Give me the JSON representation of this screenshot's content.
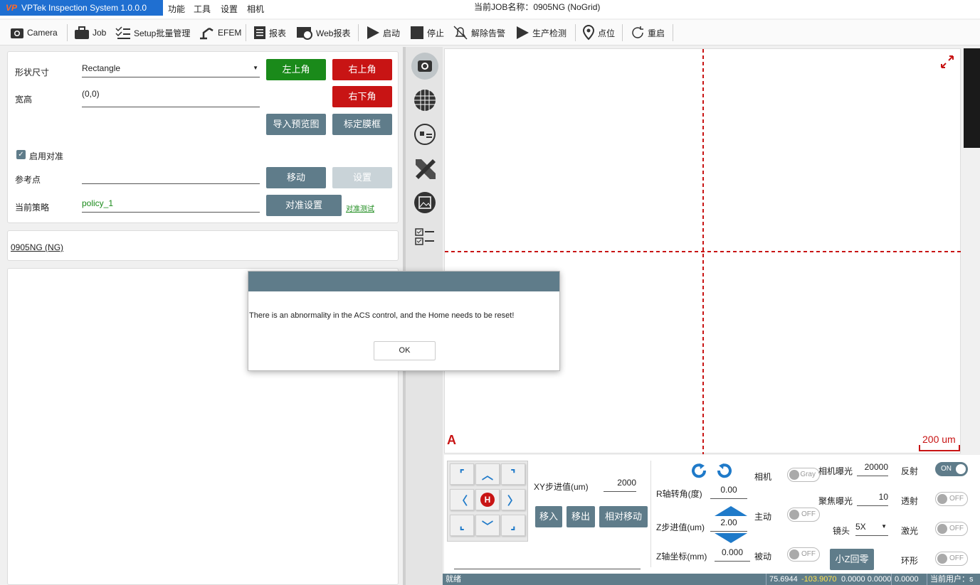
{
  "app": {
    "title": "VPTek Inspection System 1.0.0.0",
    "logo_text": "VP",
    "job_name": "当前JOB名称：0905NG (NoGrid)"
  },
  "menu": [
    "功能",
    "工具",
    "设置",
    "相机"
  ],
  "toolbar": {
    "camera": "Camera",
    "job": "Job",
    "setup": "Setup批量管理",
    "efem": "EFEM",
    "report": "报表",
    "web_report": "Web报表",
    "start": "启动",
    "stop": "停止",
    "clear_alarm": "解除告警",
    "production": "生产检测",
    "point": "点位",
    "restart": "重启"
  },
  "panel": {
    "shape_label": "形状尺寸",
    "shape_value": "Rectangle",
    "size_label": "宽高",
    "size_value": "(0,0)",
    "btn_top_left": "左上角",
    "btn_top_right": "右上角",
    "btn_bottom_right": "右下角",
    "btn_import_preview": "导入预览图",
    "btn_calibrate_frame": "标定膜框",
    "enable_align_label": "启用对准",
    "enable_align_checked": true,
    "ref_point_label": "参考点",
    "ref_point_value": "",
    "btn_move": "移动",
    "btn_set": "设置",
    "policy_label": "当前策略",
    "policy_value": "policy_1",
    "btn_align_settings": "对准设置",
    "align_test_link": "对准测试",
    "job_item": "0905NG (NG)"
  },
  "camera_view": {
    "label_a": "A",
    "scale_label": "200 um"
  },
  "controls": {
    "xy_step_label": "XY步进值(um)",
    "xy_step_value": "2000",
    "btn_move_in": "移入",
    "btn_move_out": "移出",
    "btn_relative_move": "相对移动",
    "home_label": "H",
    "r_angle_label": "R轴转角(度)",
    "r_angle_value": "0.00",
    "z_step_label": "Z步进值(um)",
    "z_step_value": "2.00",
    "z_coord_label": "Z轴坐标(mm)",
    "z_coord_value": "0.000",
    "camera_label": "相机",
    "camera_toggle": "Gray",
    "active_label": "主动",
    "active_toggle": "OFF",
    "passive_label": "被动",
    "passive_toggle": "OFF",
    "btn_small_z_home": "小Z回零",
    "exposure_label": "相机曝光",
    "exposure_value": "20000",
    "focus_exposure_label": "聚焦曝光",
    "focus_exposure_value": "10",
    "lens_label": "镜头",
    "lens_value": "5X",
    "reflect_label": "反射",
    "reflect_toggle": "ON",
    "transmit_label": "透射",
    "transmit_toggle": "OFF",
    "laser_label": "激光",
    "laser_toggle": "OFF",
    "ring_label": "环形",
    "ring_toggle": "OFF"
  },
  "status": {
    "state": "就绪",
    "coord_x": "75.6944",
    "coord_y": "-103.9070",
    "coord_rest": "0.0000 0.0000",
    "coord_extra": "0.0000",
    "user_label": "当前用户：s"
  },
  "modal": {
    "message": "There is an abnormality in the ACS control, and the Home needs to be reset!",
    "ok": "OK"
  },
  "colors": {
    "title_blue": "#1f6fd1",
    "slate": "#5f7c8a",
    "green": "#1a8a1a",
    "red": "#c81414",
    "crosshair": "#c81414",
    "arrow_blue": "#1f7ac9"
  }
}
